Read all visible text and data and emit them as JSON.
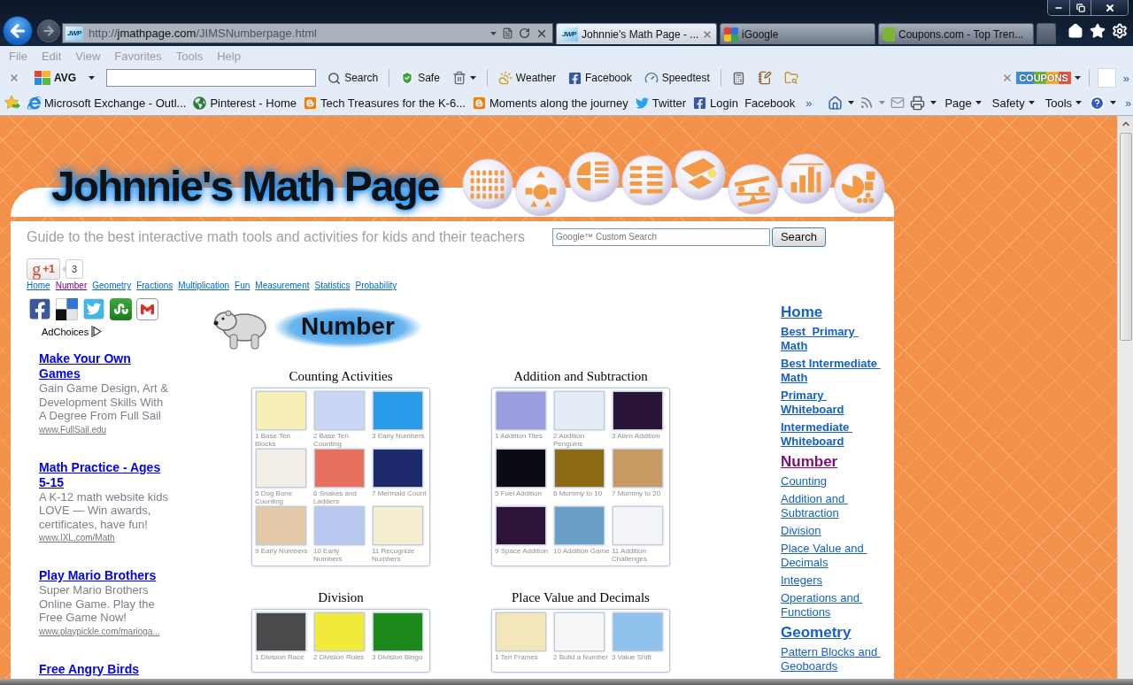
{
  "address_bar": {
    "favicon": "JWP",
    "url": "http://**jmathpage.com**/JIMSNumberpage.html"
  },
  "tabs": [
    {
      "kind": "site",
      "favicon": "JWP",
      "title": "Johnnie's Math Page - ...",
      "selected": true
    },
    {
      "kind": "google",
      "title": "iGoogle",
      "selected": false
    },
    {
      "kind": "coupon",
      "title": "Coupons.com - Top Tren...",
      "selected": false
    }
  ],
  "menu_bar": [
    "File",
    "Edit",
    "View",
    "Favorites",
    "Tools",
    "Help"
  ],
  "toolbar": {
    "items": [
      {
        "kind": "brand",
        "label": "AVG"
      },
      {
        "kind": "search_field"
      },
      {
        "kind": "search",
        "label": "Search"
      },
      {
        "kind": "separator"
      },
      {
        "kind": "safe",
        "label": "Safe"
      },
      {
        "kind": "trash"
      },
      {
        "kind": "separator"
      },
      {
        "kind": "weather",
        "label": "Weather"
      },
      {
        "kind": "facebook",
        "label": "Facebook"
      },
      {
        "kind": "speedtest",
        "label": "Speedtest"
      },
      {
        "kind": "separator"
      },
      {
        "kind": "calculator"
      },
      {
        "kind": "notepad"
      },
      {
        "kind": "folder_search"
      }
    ],
    "coupons": "COUPONS",
    "more": "»"
  },
  "favorites_bar": {
    "items": [
      {
        "kind": "ie",
        "label": "Microsoft Exchange - Outl..."
      },
      {
        "kind": "globe",
        "label": "Pinterest - Home"
      },
      {
        "kind": "blogger",
        "label": "Tech Treasures for the K-6..."
      },
      {
        "kind": "blogger",
        "label": "Moments along the journey"
      },
      {
        "kind": "twitter",
        "label": "Twitter"
      },
      {
        "kind": "facebook",
        "label": "Login  Facebook"
      }
    ],
    "more": "»"
  },
  "command_bar": {
    "items": [
      {
        "kind": "home"
      },
      {
        "kind": "feeds"
      },
      {
        "kind": "mail"
      },
      {
        "kind": "print"
      },
      {
        "kind": "menu",
        "label": "Page"
      },
      {
        "kind": "menu",
        "label": "Safety"
      },
      {
        "kind": "menu",
        "label": "Tools"
      },
      {
        "kind": "help"
      }
    ],
    "more": "»"
  },
  "page": {
    "logo": "Johnnie's Math Page",
    "tagline": "Guide to the best interactive math tools and activities for kids and their teachers",
    "site_search": {
      "placeholder": "Google™ Custom Search",
      "button": "Search"
    },
    "plus_one": {
      "mark": "g",
      "label": "+1",
      "count": "3"
    },
    "topic_links": [
      {
        "label": "Home",
        "visited": false
      },
      {
        "label": "Number",
        "visited": true
      },
      {
        "label": "Geometry",
        "visited": false
      },
      {
        "label": "Fractions",
        "visited": false
      },
      {
        "label": "Multiplication",
        "visited": false
      },
      {
        "label": "Fun",
        "visited": false
      },
      {
        "label": "Measurement",
        "visited": false
      },
      {
        "label": "Statistics",
        "visited": false
      },
      {
        "label": "Probability",
        "visited": false
      }
    ],
    "share_buttons": [
      {
        "kind": "facebook"
      },
      {
        "kind": "delicious"
      },
      {
        "kind": "twitter"
      },
      {
        "kind": "stumbleupon"
      },
      {
        "kind": "gmail"
      }
    ],
    "ad_choices": "AdChoices",
    "ads": [
      {
        "title": "Make Your Own Games",
        "text": "Gain Game Design, Art & Development Skills With A Degree From Full Sail",
        "url": "www.FullSail.edu"
      },
      {
        "title": "Math Practice - Ages 5-15",
        "text": "A K-12 math website kids LOVE — Win awards, certificates, have fun!",
        "url": "www.IXL.com/Math"
      },
      {
        "title": "Play Mario Brothers",
        "text": "Super Mario Brothers Online Game. Play the Free Game Now!",
        "url": "www.playpickle.com/marioga..."
      },
      {
        "title": "Free Angry Birds"
      }
    ],
    "heading": "Number",
    "sections": [
      {
        "title": "Counting Activities",
        "games": [
          {
            "caption": "1 Base Ten Blocks"
          },
          {
            "caption": "2 Base Ten Counting"
          },
          {
            "caption": "3 Early Numbers"
          },
          {
            "caption": "5 Dog Bone Counting"
          },
          {
            "caption": "6 Snakes and Ladders"
          },
          {
            "caption": "7 Mermaid Count"
          },
          {
            "caption": "9 Early Numbers"
          },
          {
            "caption": "10 Early Numbers"
          },
          {
            "caption": "11 Recognize Numbers"
          }
        ]
      },
      {
        "title": "Addition and Subtraction",
        "games": [
          {
            "caption": "1 Addition Tiles"
          },
          {
            "caption": "2 Addition Penguins"
          },
          {
            "caption": "3 Alien Addition"
          },
          {
            "caption": "5 Fuel Addition"
          },
          {
            "caption": "6 Mummy to 10"
          },
          {
            "caption": "7 Mummy to 20"
          },
          {
            "caption": "9 Space Addition"
          },
          {
            "caption": "10 Addition Game"
          },
          {
            "caption": "11 Addition Challenges"
          }
        ]
      },
      {
        "title": "Division",
        "games": [
          {
            "caption": "1 Division Race"
          },
          {
            "caption": "2 Division Rules"
          },
          {
            "caption": "3 Division Bingo"
          }
        ]
      },
      {
        "title": "Place Value and Decimals",
        "games": [
          {
            "caption": "1 Ten Frames"
          },
          {
            "caption": "2 Build a Number"
          },
          {
            "caption": "3 Value Shift"
          }
        ]
      }
    ],
    "side_nav": [
      {
        "kind": "heading",
        "label": "Home",
        "visited": false
      },
      {
        "kind": "bold",
        "label": "Best  Primary Math",
        "visited": false
      },
      {
        "kind": "bold",
        "label": "Best Intermediate Math",
        "visited": false
      },
      {
        "kind": "bold",
        "label": "Primary Whiteboard",
        "visited": false
      },
      {
        "kind": "bold",
        "label": "Intermediate Whiteboard",
        "visited": false
      },
      {
        "kind": "heading",
        "label": "Number",
        "visited": true
      },
      {
        "kind": "link",
        "label": "Counting",
        "visited": false
      },
      {
        "kind": "link",
        "label": "Addition and Subtraction",
        "visited": false
      },
      {
        "kind": "link",
        "label": "Division",
        "visited": false
      },
      {
        "kind": "link",
        "label": "Place Value and Decimals",
        "visited": false
      },
      {
        "kind": "link",
        "label": "Integers",
        "visited": false
      },
      {
        "kind": "link",
        "label": "Operations and Functions",
        "visited": false
      },
      {
        "kind": "heading",
        "label": "Geometry",
        "visited": false
      },
      {
        "kind": "link",
        "label": "Pattern Blocks and Geoboards",
        "visited": false
      }
    ]
  }
}
